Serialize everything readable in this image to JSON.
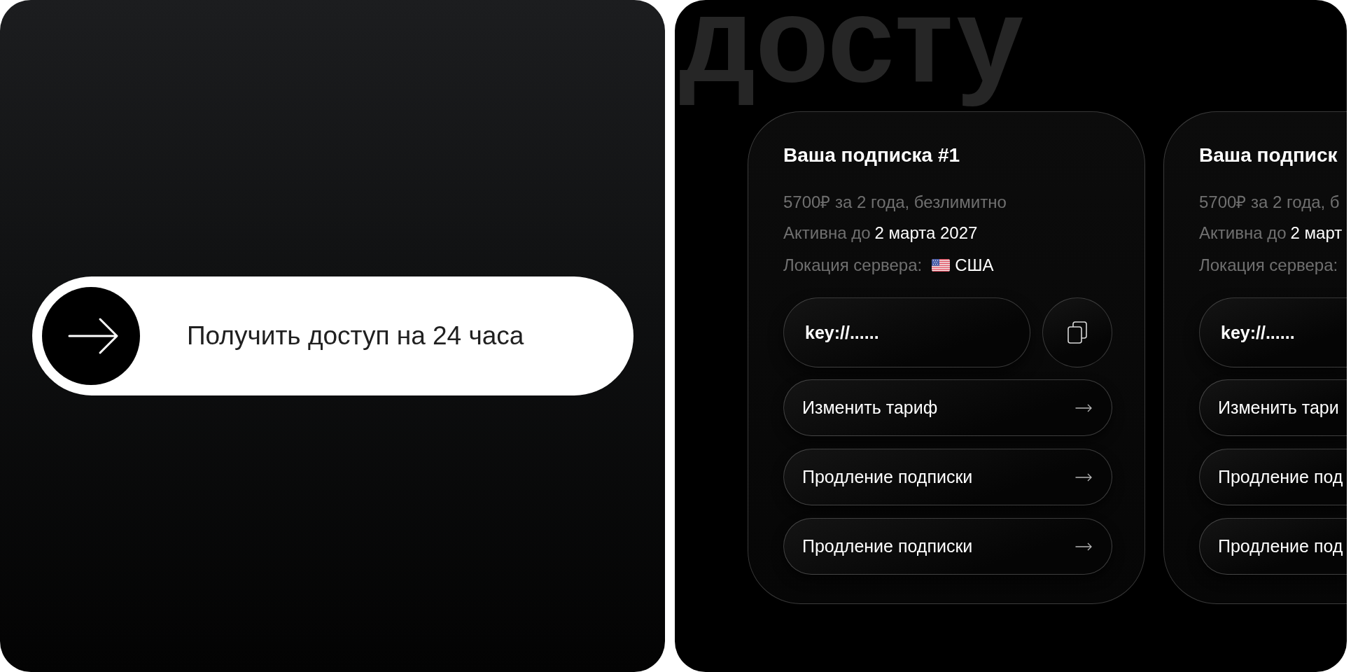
{
  "left_panel": {
    "button": {
      "label": "Получить доступ на 24 часа"
    }
  },
  "right_panel": {
    "background_text": "досту",
    "cards": [
      {
        "title": "Ваша подписка #1",
        "plan": "5700₽ за 2 года, безлимитно",
        "active_label": "Активна до",
        "active_date": "2 марта 2027",
        "location_label": "Локация сервера:",
        "location": "США",
        "key_field": {
          "value": "key://......"
        },
        "actions": [
          "Изменить тариф",
          "Продление подписки",
          "Продление подписки"
        ]
      },
      {
        "title": "Ваша подписк",
        "plan": "5700₽ за 2 года, б",
        "active_label": "Активна до",
        "active_date": "2 март",
        "location_label": "Локация сервера:",
        "key_field": {
          "value": "key://......"
        },
        "actions": [
          "Изменить тари",
          "Продление под",
          "Продление под"
        ]
      }
    ]
  }
}
